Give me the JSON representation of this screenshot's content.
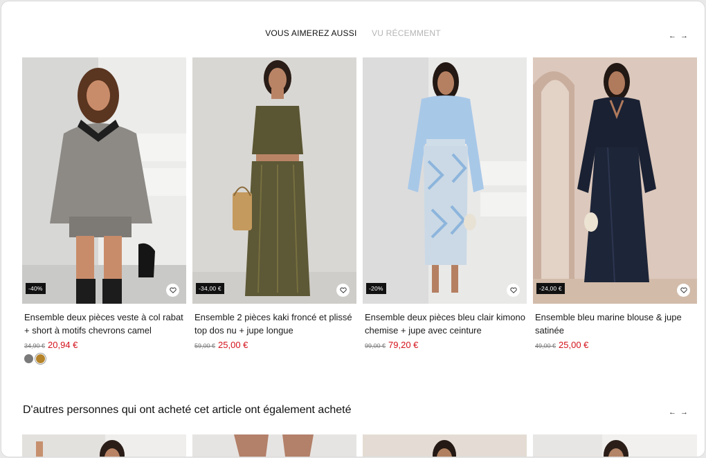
{
  "tabs": [
    {
      "label": "VOUS AIMEREZ AUSSI",
      "active": true
    },
    {
      "label": "VU RÉCEMMENT",
      "active": false
    }
  ],
  "nav": {
    "prev": "←",
    "next": "→"
  },
  "products": [
    {
      "name": "Ensemble deux pièces veste à col rabat + short à motifs chevrons camel",
      "old_price": "34,90 €",
      "price": "20,94 €",
      "badge": "-40%",
      "swatches": [
        "#7a7a7a",
        "#b5842a"
      ]
    },
    {
      "name": "Ensemble 2 pièces kaki froncé et plissé top dos nu + jupe longue",
      "old_price": "59,00 €",
      "price": "25,00 €",
      "badge": "-34,00 €",
      "swatches": []
    },
    {
      "name": "Ensemble deux pièces bleu clair kimono chemise + jupe avec ceinture",
      "old_price": "99,00 €",
      "price": "79,20 €",
      "badge": "-20%",
      "swatches": []
    },
    {
      "name": "Ensemble bleu marine blouse & jupe satinée",
      "old_price": "49,00 €",
      "price": "25,00 €",
      "badge": "-24,00 €",
      "swatches": []
    }
  ],
  "section2": {
    "title": "D'autres personnes qui ont acheté cet article ont également acheté"
  },
  "colors": {
    "sale": "#d3121b",
    "inactive_tab": "#b5b5b5"
  }
}
